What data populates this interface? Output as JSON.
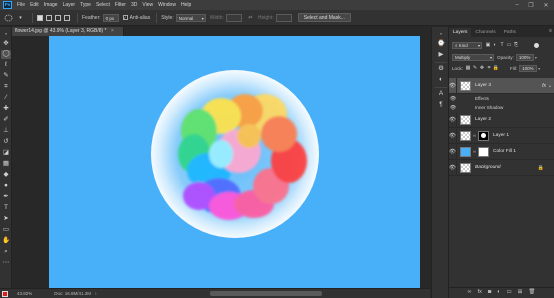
{
  "menu": {
    "logo": "Ps",
    "items": [
      "File",
      "Edit",
      "Image",
      "Layer",
      "Type",
      "Select",
      "Filter",
      "3D",
      "View",
      "Window",
      "Help"
    ]
  },
  "window_controls": {
    "minimize": "–",
    "restore": "❐",
    "close": "✕"
  },
  "options": {
    "feather_label": "Feather:",
    "feather_value": "0 px",
    "antialias_label": "Anti-alias",
    "antialias_check": "✓",
    "style_label": "Style:",
    "style_value": "Normal",
    "width_label": "Width:",
    "height_label": "Height:",
    "select_mask_button": "Select and Mask..."
  },
  "document": {
    "tab_title": "flower14.jpg @ 43.9% (Layer 3, RGB/8) *",
    "close": "×"
  },
  "status": {
    "zoom": "43.82%",
    "doc": "Doc: 16.8M/41.2M",
    "arrow": "›"
  },
  "panel": {
    "tabs": [
      "Layers",
      "Channels",
      "Paths"
    ],
    "menu_icon": "≡",
    "kind_label": "Kind",
    "blend_mode": "Multiply",
    "opacity_label": "Opacity:",
    "opacity_value": "100%",
    "lock_label": "Lock:",
    "fill_label": "Fill:",
    "fill_value": "100%",
    "layers": [
      {
        "name": "Layer 3",
        "fx": "fx"
      },
      {
        "name": "Layer 2"
      },
      {
        "name": "Layer 1"
      },
      {
        "name": "Color Fill 1"
      },
      {
        "name": "Background"
      }
    ],
    "effects_label": "Effects",
    "inner_shadow_label": "Inner Shadow"
  },
  "colors": {
    "canvas_bg": "#47b0f8",
    "foreground": "#e41b1b",
    "background": "#ffffff",
    "accent": "#31a8ff"
  }
}
